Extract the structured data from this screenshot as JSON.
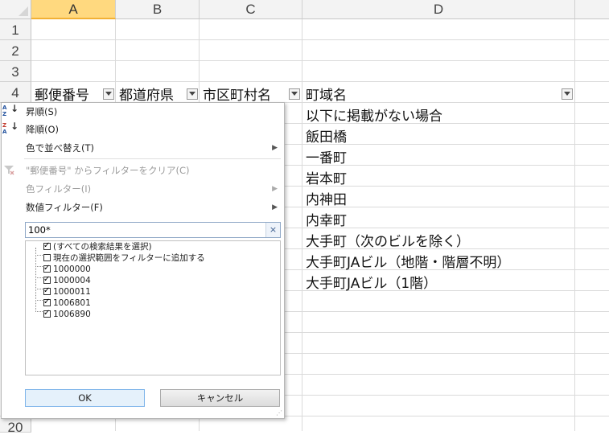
{
  "columns": [
    "A",
    "B",
    "C",
    "D"
  ],
  "rows": [
    "1",
    "2",
    "3",
    "4",
    "20"
  ],
  "header_row": {
    "a": "郵便番号",
    "b": "都道府県",
    "c": "市区町村名",
    "d": "町域名"
  },
  "data_cells": [
    "以下に掲載がない場合",
    "飯田橋",
    "一番町",
    "岩本町",
    "内神田",
    "内幸町",
    "大手町（次のビルを除く）",
    "大手町JAビル（地階・階層不明）",
    "大手町JAビル（1階）"
  ],
  "menu": {
    "sort_asc": "昇順(S)",
    "sort_desc": "降順(O)",
    "sort_color": "色で並べ替え(T)",
    "clear_filter": "\"郵便番号\" からフィルターをクリア(C)",
    "color_filter": "色フィルター(I)",
    "number_filter": "数値フィルター(F)",
    "sort_asc_icon": "A/Z",
    "sort_desc_icon": "Z/A"
  },
  "search": {
    "value": "100*",
    "clear_icon": "×"
  },
  "list_items": [
    {
      "label": "(すべての検索結果を選択)",
      "checked": true
    },
    {
      "label": "現在の選択範囲をフィルターに追加する",
      "checked": false
    },
    {
      "label": "1000000",
      "checked": true
    },
    {
      "label": "1000004",
      "checked": true
    },
    {
      "label": "1000011",
      "checked": true
    },
    {
      "label": "1006801",
      "checked": true
    },
    {
      "label": "1006890",
      "checked": true
    }
  ],
  "buttons": {
    "ok": "OK",
    "cancel": "キャンセル"
  },
  "colors": {
    "selected_column": "#ffd97f",
    "ok_button": "#e5f1fb"
  }
}
